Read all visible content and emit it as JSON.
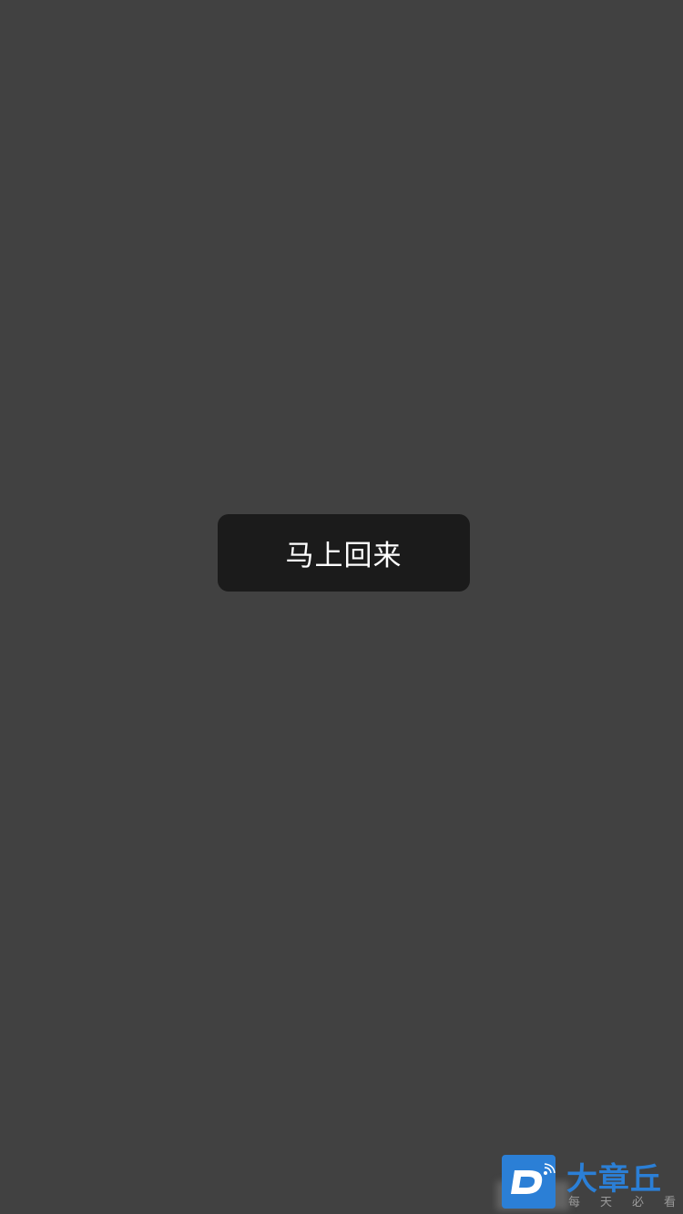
{
  "toast": {
    "text": "马上回来"
  },
  "watermark": {
    "logo_letter": "D",
    "logo_icon": "signal-waves-icon",
    "brand": "大章丘",
    "slogan": "每天必看",
    "brand_color": "#2b7fd6"
  },
  "colors": {
    "background": "#414141",
    "toast_background": "#1b1b1b",
    "toast_text": "#ffffff"
  }
}
